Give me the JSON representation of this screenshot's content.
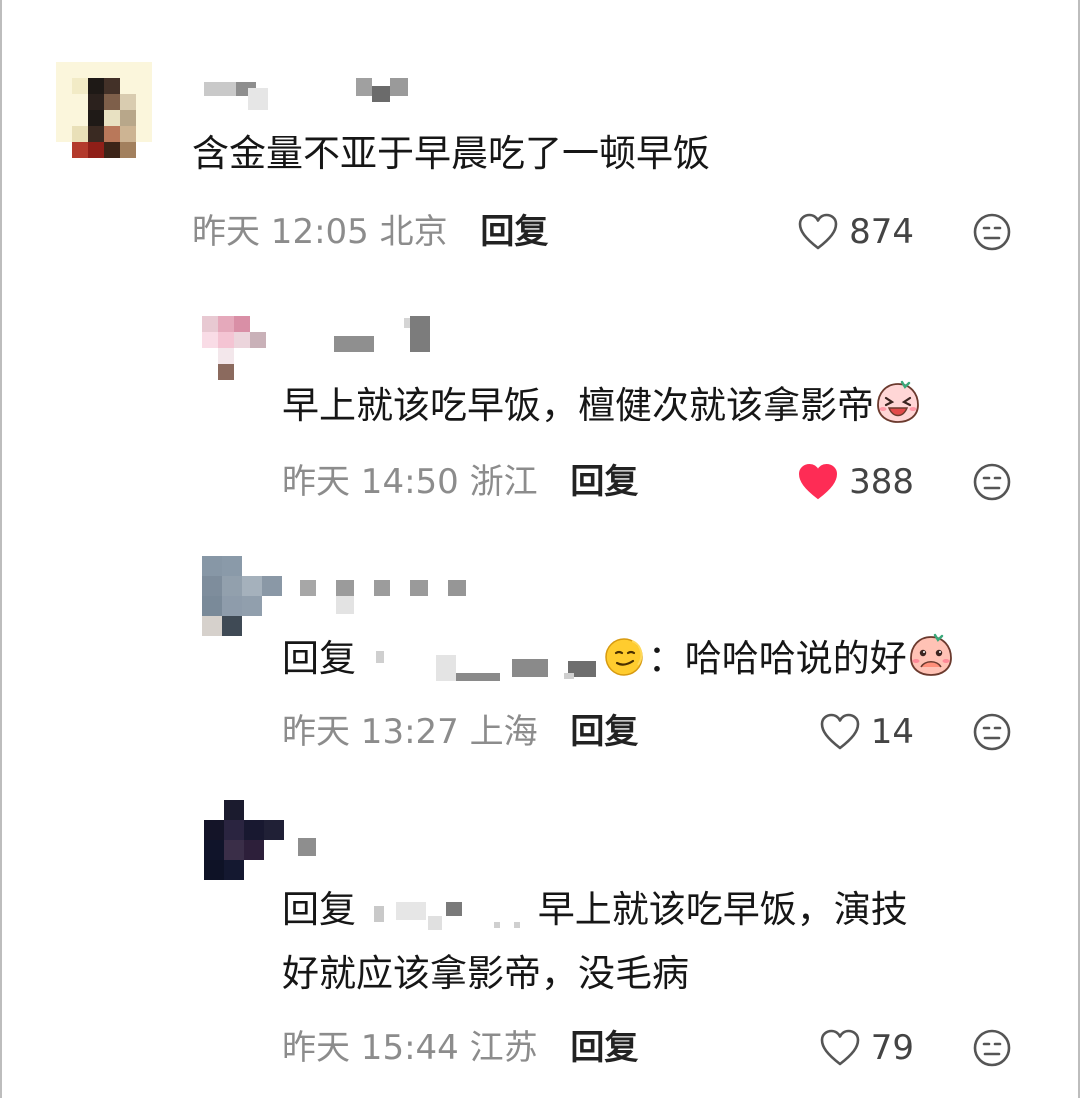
{
  "comments": [
    {
      "text": "含金量不亚于早晨吃了一顿早饭",
      "time": "昨天 12:05",
      "location": "北京",
      "reply_label": "回复",
      "likes": "874",
      "liked": false
    },
    {
      "text": "早上就该吃早饭，檀健次就该拿影帝",
      "time": "昨天 14:50",
      "location": "浙江",
      "reply_label": "回复",
      "likes": "388",
      "liked": true
    },
    {
      "prefix": "回复",
      "colon": "：",
      "text": "哈哈哈说的好",
      "time": "昨天 13:27",
      "location": "上海",
      "reply_label": "回复",
      "likes": "14",
      "liked": false
    },
    {
      "prefix": "回复",
      "text_line1": "早上就该吃早饭，演技",
      "text_line2": "好就应该拿影帝，没毛病",
      "time": "昨天 15:44",
      "location": "江苏",
      "reply_label": "回复",
      "likes": "79",
      "liked": false
    }
  ],
  "colors": {
    "liked": "#fe2c55",
    "meta": "#8c8c8c",
    "text": "#161616"
  }
}
